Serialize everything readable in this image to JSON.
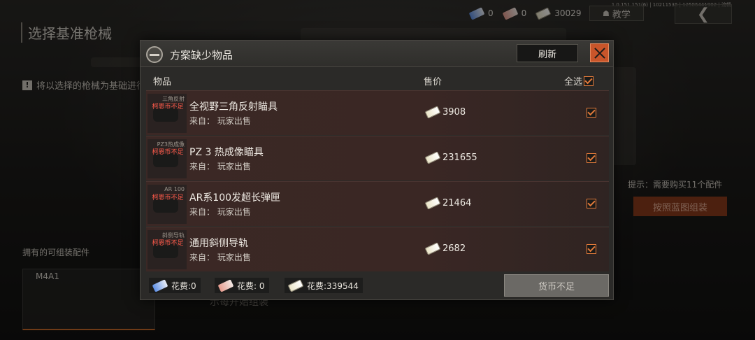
{
  "version": "1.0.151.151(6) | 10211536 | 12586441902 | 流畅",
  "currencies": [
    {
      "icon": "blue-chip-icon",
      "value": "0"
    },
    {
      "icon": "pink-chip-icon",
      "value": "0"
    },
    {
      "icon": "cash-icon",
      "value": "30029"
    }
  ],
  "tutorial_label": "教学",
  "back_icon": "chevron-left-icon",
  "page": {
    "title": "选择基准枪械",
    "hint": "将以选择的枪械为基础进行",
    "owned_label": "拥有的可组装配件",
    "weapon": "M4A1",
    "right_hint": "提示：需要购买11个配件",
    "assemble_button": "按照蓝图组装",
    "behind_text": "示每开始组装"
  },
  "dialog": {
    "title": "方案缺少物品",
    "refresh_label": "刷新",
    "columns": {
      "item": "物品",
      "price": "售价",
      "select_all": "全选"
    },
    "items": [
      {
        "tag": "三角反射",
        "warning": "柯恩币不足",
        "name": "全视野三角反射瞄具",
        "source": "来自： 玩家出售",
        "price": "3908"
      },
      {
        "tag": "PZ3热成像",
        "warning": "柯恩币不足",
        "name": "PZ 3 热成像瞄具",
        "source": "来自： 玩家出售",
        "price": "231655"
      },
      {
        "tag": "AR 100",
        "warning": "柯恩币不足",
        "name": "AR系100发超长弹匣",
        "source": "来自： 玩家出售",
        "price": "21464"
      },
      {
        "tag": "斜侧导轨",
        "warning": "柯恩币不足",
        "name": "通用斜侧导轨",
        "source": "来自： 玩家出售",
        "price": "2682"
      }
    ],
    "footer": {
      "cost_blue": "花费:0",
      "cost_pink": "花费: 0",
      "cost_cash": "花费:339544",
      "insufficient_label": "货币不足"
    }
  },
  "colors": {
    "accent": "#e27a3a",
    "close": "#c9552a",
    "warning": "#ff5a4a"
  }
}
